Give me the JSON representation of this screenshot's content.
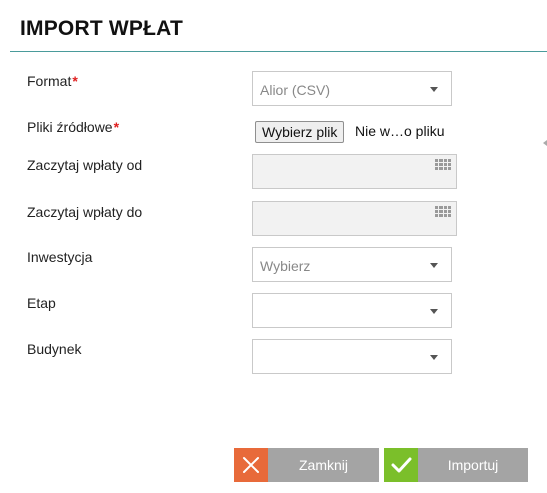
{
  "dialog": {
    "title": "IMPORT WPŁAT"
  },
  "form": {
    "format": {
      "label": "Format",
      "value": "Alior (CSV)"
    },
    "files": {
      "label": "Pliki źródłowe",
      "button": "Wybierz plik",
      "status": "Nie w…o pliku"
    },
    "date_from": {
      "label": "Zaczytaj wpłaty od",
      "value": ""
    },
    "date_to": {
      "label": "Zaczytaj wpłaty do",
      "value": ""
    },
    "investment": {
      "label": "Inwestycja",
      "value": "Wybierz"
    },
    "stage": {
      "label": "Etap",
      "value": ""
    },
    "building": {
      "label": "Budynek",
      "value": ""
    },
    "required_marker": "*"
  },
  "actions": {
    "close_label": "Zamknij",
    "import_label": "Importuj"
  },
  "icons": {
    "select": "chevron-down-icon",
    "date": "calendar-icon",
    "close": "close-icon",
    "import": "check-icon"
  },
  "colors": {
    "accent_rule": "#4a9b9b",
    "required": "#e02020",
    "close_icon_bg": "#e86a3a",
    "import_icon_bg": "#7bbf2a",
    "button_bg": "#a4a4a4"
  }
}
